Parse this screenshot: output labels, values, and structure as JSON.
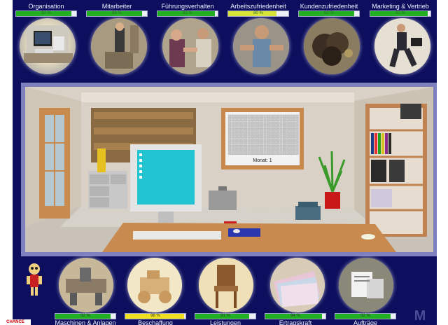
{
  "top_kpis": [
    {
      "label": "Organisation",
      "pct": 0.92,
      "pct_label": "92 %",
      "color": "#22b022"
    },
    {
      "label": "Mitarbeiter",
      "pct": 0.92,
      "pct_label": "84 %",
      "color": "#22b022"
    },
    {
      "label": "Führungsverhalten",
      "pct": 0.95,
      "pct_label": "92 %",
      "color": "#22b022"
    },
    {
      "label": "Arbeitszufriedenheit",
      "pct": 0.8,
      "pct_label": "80 %",
      "color": "#d8e33a"
    },
    {
      "label": "Kundenzufriedenheit",
      "pct": 0.92,
      "pct_label": "92 %",
      "color": "#22b022"
    },
    {
      "label": "Marketing & Vertrieb",
      "pct": 0.95,
      "pct_label": "92 %",
      "color": "#22b022"
    }
  ],
  "top_icons": [
    "computer-workstation-icon",
    "employee-icon",
    "handshake-icon",
    "worker-icon",
    "crowd-icon",
    "businessman-running-icon"
  ],
  "office": {
    "board_label": "Monat: 1"
  },
  "bottom_kpis": [
    {
      "label": "Maschinen & Anlagen",
      "pct": 0.92,
      "pct_label": "92 %",
      "color": "#22b022"
    },
    {
      "label": "Beschaffung",
      "pct": 0.98,
      "pct_label": "98 %",
      "color": "#f0e020"
    },
    {
      "label": "Leistungen",
      "pct": 0.9,
      "pct_label": "91 %",
      "color": "#22b022"
    },
    {
      "label": "Ertragskraft",
      "pct": 0.94,
      "pct_label": "94 %",
      "color": "#22b022"
    },
    {
      "label": "Aufträge",
      "pct": 0.92,
      "pct_label": "92 %",
      "color": "#22b022"
    }
  ],
  "bottom_icons": [
    "machine-icon",
    "wooden-toy-icon",
    "chair-icon",
    "money-icon",
    "orders-icon"
  ],
  "brand_logo": "CHANCE",
  "brand_letter": "M"
}
